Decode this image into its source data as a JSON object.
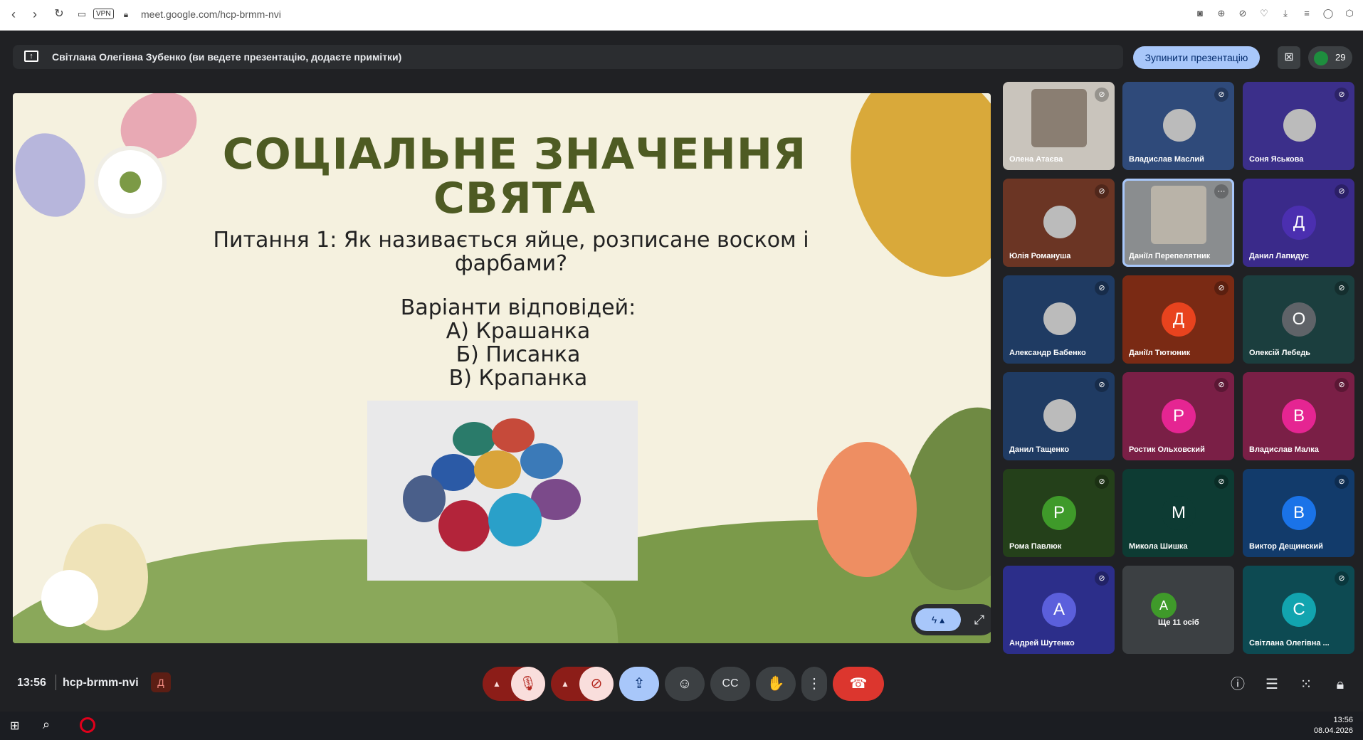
{
  "browser": {
    "vpn_label": "VPN",
    "url": "meet.google.com/hcp-brmm-nvi"
  },
  "banner": {
    "text": "Світлана Олегівна Зубенко (ви ведете презентацію, додаєте примітки)",
    "stop_label": "Зупинити презентацію",
    "participant_count": "29"
  },
  "slide": {
    "title_line1": "СОЦІАЛЬНЕ ЗНАЧЕННЯ",
    "title_line2": "СВЯТА",
    "question_line1": "Питання 1: Як називається яйце, розписане воском і",
    "question_line2": "фарбами?",
    "answers_title": "Варіанти відповідей:",
    "answer_a": "А) Крашанка",
    "answer_b": "Б) Писанка",
    "answer_c": "В) Крапанка"
  },
  "participants": [
    {
      "name": "Олена Атаєва",
      "kind": "photo",
      "bg": "#c9c4bc"
    },
    {
      "name": "Владислав Маслий",
      "kind": "photo",
      "bg": "#2f4a7a"
    },
    {
      "name": "Соня Яськова",
      "kind": "photo",
      "bg": "#3b2f8a"
    },
    {
      "name": "Юлія Романуша",
      "kind": "photo",
      "bg": "#6b3524"
    },
    {
      "name": "Даніїл Перепелятник",
      "kind": "photo",
      "bg": "#8a8d8f"
    },
    {
      "name": "Данил Лапидус",
      "letter": "Д",
      "bg": "#3a2a8a",
      "av": "#4b2fb0"
    },
    {
      "name": "Александр Бабенко",
      "kind": "photo",
      "bg": "#1f3b63"
    },
    {
      "name": "Даніїл Тютюник",
      "letter": "Д",
      "bg": "#7a2a14",
      "av": "#e8431e"
    },
    {
      "name": "Олексій Лебедь",
      "letter": "О",
      "bg": "#1b3e3e",
      "av": "#5f6368"
    },
    {
      "name": "Данил Тащенко",
      "kind": "photo",
      "bg": "#1f3b63"
    },
    {
      "name": "Ростик Ольховский",
      "letter": "Р",
      "bg": "#7a1f46",
      "av": "#e52592"
    },
    {
      "name": "Владислав Малка",
      "letter": "В",
      "bg": "#7a1f46",
      "av": "#e52592"
    },
    {
      "name": "Рома Павлюк",
      "letter": "Р",
      "bg": "#24401a",
      "av": "#3f9a2a"
    },
    {
      "name": "Микола Шишка",
      "letter": "М",
      "bg": "#0d3b33",
      "av": "#0d3b33"
    },
    {
      "name": "Виктор Дещинский",
      "letter": "В",
      "bg": "#123b6b",
      "av": "#1a73e8"
    },
    {
      "name": "Андрей Шутенко",
      "letter": "А",
      "bg": "#2c2e8a",
      "av": "#5b5fdc"
    },
    {
      "name": "Ще 11 осіб",
      "letter": "А",
      "bg": "#3c4043",
      "av": "#3f9a2a"
    },
    {
      "name": "Світлана Олегівна ...",
      "letter": "С",
      "bg": "#0d4a52",
      "av": "#12a4af"
    }
  ],
  "bottom": {
    "time": "13:56",
    "meeting_code": "hcp-brmm-nvi"
  },
  "taskbar": {
    "time": "13:56",
    "date": "08.04.2026"
  }
}
